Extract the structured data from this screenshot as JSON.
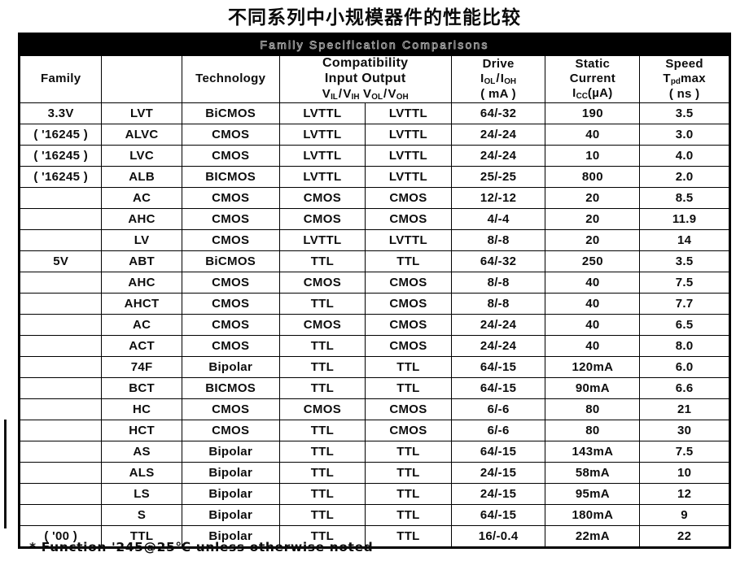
{
  "page": {
    "title": "不同系列中小规模器件的性能比较"
  },
  "table": {
    "banner": "Family Specification Comparisons",
    "headers": {
      "family": "Family",
      "subfamily": "",
      "technology": "Technology",
      "compatibility": {
        "line1": "Compatibility",
        "line2": "Input Output",
        "input_low": "V",
        "input_low_sub": "IL",
        "input_high": "V",
        "input_high_sub": "IH",
        "output_low": "V",
        "output_low_sub": "OL",
        "output_high": "V",
        "output_high_sub": "OH"
      },
      "drive": {
        "line1": "Drive",
        "sym_a": "I",
        "sym_a_sub": "OL",
        "sym_b": "I",
        "sym_b_sub": "OH",
        "units": "( mA )"
      },
      "static_current": {
        "line1": "Static",
        "line2": "Current",
        "sym": "I",
        "sym_sub": "CC",
        "units": "(µA)"
      },
      "speed": {
        "line1": "Speed",
        "sym": "T",
        "sym_sub": "pd",
        "sym_tail": "max",
        "units": "( ns )"
      }
    },
    "rows": [
      {
        "family": "3.3V",
        "subfamily": "LVT",
        "technology": "BiCMOS",
        "input": "LVTTL",
        "output": "LVTTL",
        "drive": "64/-32",
        "static": "190",
        "speed": "3.5"
      },
      {
        "family": "( '16245 )",
        "subfamily": "ALVC",
        "technology": "CMOS",
        "input": "LVTTL",
        "output": "LVTTL",
        "drive": "24/-24",
        "static": "40",
        "speed": "3.0"
      },
      {
        "family": "( '16245 )",
        "subfamily": "LVC",
        "technology": "CMOS",
        "input": "LVTTL",
        "output": "LVTTL",
        "drive": "24/-24",
        "static": "10",
        "speed": "4.0"
      },
      {
        "family": "( '16245 )",
        "subfamily": "ALB",
        "technology": "BICMOS",
        "input": "LVTTL",
        "output": "LVTTL",
        "drive": "25/-25",
        "static": "800",
        "speed": "2.0"
      },
      {
        "family": "",
        "subfamily": "AC",
        "technology": "CMOS",
        "input": "CMOS",
        "output": "CMOS",
        "drive": "12/-12",
        "static": "20",
        "speed": "8.5"
      },
      {
        "family": "",
        "subfamily": "AHC",
        "technology": "CMOS",
        "input": "CMOS",
        "output": "CMOS",
        "drive": "4/-4",
        "static": "20",
        "speed": "11.9"
      },
      {
        "family": "",
        "subfamily": "LV",
        "technology": "CMOS",
        "input": "LVTTL",
        "output": "LVTTL",
        "drive": "8/-8",
        "static": "20",
        "speed": "14"
      },
      {
        "family": "5V",
        "subfamily": "ABT",
        "technology": "BiCMOS",
        "input": "TTL",
        "output": "TTL",
        "drive": "64/-32",
        "static": "250",
        "speed": "3.5"
      },
      {
        "family": "",
        "subfamily": "AHC",
        "technology": "CMOS",
        "input": "CMOS",
        "output": "CMOS",
        "drive": "8/-8",
        "static": "40",
        "speed": "7.5"
      },
      {
        "family": "",
        "subfamily": "AHCT",
        "technology": "CMOS",
        "input": "TTL",
        "output": "CMOS",
        "drive": "8/-8",
        "static": "40",
        "speed": "7.7"
      },
      {
        "family": "",
        "subfamily": "AC",
        "technology": "CMOS",
        "input": "CMOS",
        "output": "CMOS",
        "drive": "24/-24",
        "static": "40",
        "speed": "6.5"
      },
      {
        "family": "",
        "subfamily": "ACT",
        "technology": "CMOS",
        "input": "TTL",
        "output": "CMOS",
        "drive": "24/-24",
        "static": "40",
        "speed": "8.0"
      },
      {
        "family": "",
        "subfamily": "74F",
        "technology": "Bipolar",
        "input": "TTL",
        "output": "TTL",
        "drive": "64/-15",
        "static": "120mA",
        "speed": "6.0"
      },
      {
        "family": "",
        "subfamily": "BCT",
        "technology": "BICMOS",
        "input": "TTL",
        "output": "TTL",
        "drive": "64/-15",
        "static": "90mA",
        "speed": "6.6"
      },
      {
        "family": "",
        "subfamily": "HC",
        "technology": "CMOS",
        "input": "CMOS",
        "output": "CMOS",
        "drive": "6/-6",
        "static": "80",
        "speed": "21"
      },
      {
        "family": "",
        "subfamily": "HCT",
        "technology": "CMOS",
        "input": "TTL",
        "output": "CMOS",
        "drive": "6/-6",
        "static": "80",
        "speed": "30"
      },
      {
        "family": "",
        "subfamily": "AS",
        "technology": "Bipolar",
        "input": "TTL",
        "output": "TTL",
        "drive": "64/-15",
        "static": "143mA",
        "speed": "7.5"
      },
      {
        "family": "",
        "subfamily": "ALS",
        "technology": "Bipolar",
        "input": "TTL",
        "output": "TTL",
        "drive": "24/-15",
        "static": "58mA",
        "speed": "10"
      },
      {
        "family": "",
        "subfamily": "LS",
        "technology": "Bipolar",
        "input": "TTL",
        "output": "TTL",
        "drive": "24/-15",
        "static": "95mA",
        "speed": "12"
      },
      {
        "family": "",
        "subfamily": "S",
        "technology": "Bipolar",
        "input": "TTL",
        "output": "TTL",
        "drive": "64/-15",
        "static": "180mA",
        "speed": "9"
      },
      {
        "family": "( '00 )",
        "subfamily": "TTL",
        "technology": "Bipolar",
        "input": "TTL",
        "output": "TTL",
        "drive": "16/-0.4",
        "static": "22mA",
        "speed": "22"
      }
    ]
  },
  "footnote": {
    "text": "* Function '245@25℃ unless otherwise noted"
  }
}
